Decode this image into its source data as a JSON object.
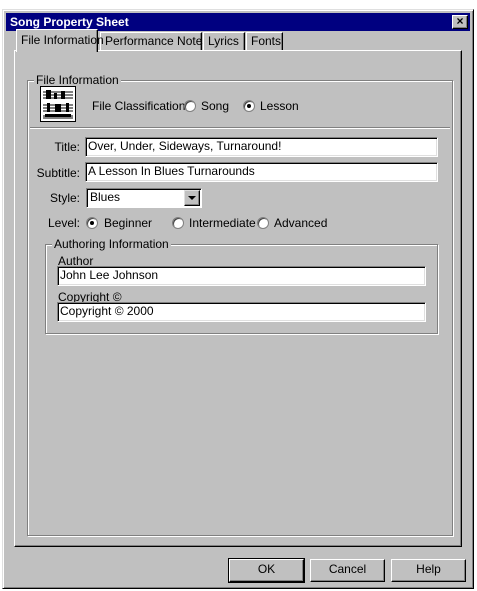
{
  "window": {
    "title": "Song Property Sheet"
  },
  "icons": {
    "close": "close-icon",
    "song_sheet": "sheet-music-icon",
    "dropdown": "chevron-down-icon"
  },
  "tabs": [
    {
      "label": "File Information",
      "active": true
    },
    {
      "label": "Performance Notes",
      "active": false
    },
    {
      "label": "Lyrics",
      "active": false
    },
    {
      "label": "Fonts",
      "active": false
    }
  ],
  "file_info": {
    "group_label": "File Information",
    "classification_label": "File Classification:",
    "classification_options": [
      "Song",
      "Lesson"
    ],
    "classification_selected": "Lesson"
  },
  "fields": {
    "title_label": "Title:",
    "title_value": "Over, Under, Sideways, Turnaround!",
    "subtitle_label": "Subtitle:",
    "subtitle_value": "A Lesson In Blues Turnarounds",
    "style_label": "Style:",
    "style_value": "Blues",
    "level_label": "Level:",
    "level_options": [
      "Beginner",
      "Intermediate",
      "Advanced"
    ],
    "level_selected": "Beginner"
  },
  "authoring": {
    "group_label": "Authoring Information",
    "author_label": "Author",
    "author_value": "John Lee Johnson",
    "copyright_label": "Copyright ©",
    "copyright_value": "Copyright © 2000"
  },
  "buttons": {
    "ok": "OK",
    "cancel": "Cancel",
    "help": "Help"
  }
}
